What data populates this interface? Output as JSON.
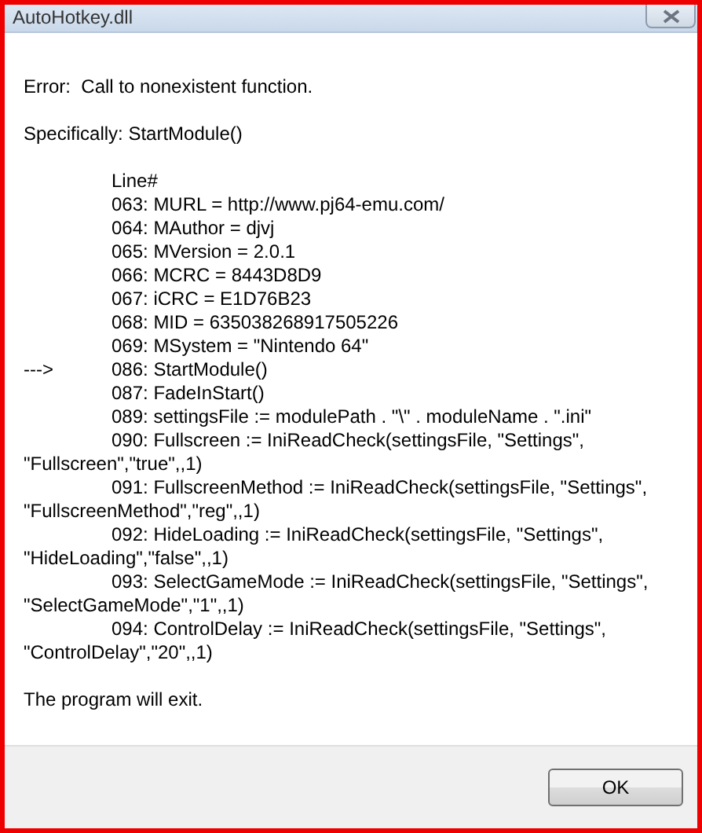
{
  "window": {
    "title": "AutoHotkey.dll"
  },
  "message": {
    "error": "Error:  Call to nonexistent function.",
    "specifically": "Specifically: StartModule()",
    "listing_header": "Line#",
    "lines": [
      {
        "text": "063: MURL = http://www.pj64-emu.com/"
      },
      {
        "text": "064: MAuthor = djvj"
      },
      {
        "text": "065: MVersion = 2.0.1"
      },
      {
        "text": "066: MCRC = 8443D8D9"
      },
      {
        "text": "067: iCRC = E1D76B23"
      },
      {
        "text": "068: MID = 635038268917505226"
      },
      {
        "text": "069: MSystem = \"Nintendo 64\""
      },
      {
        "marker": "--->",
        "text": "086: StartModule()"
      },
      {
        "text": "087: FadeInStart()"
      },
      {
        "text": "089: settingsFile := modulePath . \"\\\" . moduleName . \".ini\""
      },
      {
        "text": "090: Fullscreen := IniReadCheck(settingsFile, \"Settings\", \"Fullscreen\",\"true\",,1)"
      },
      {
        "text": "091: FullscreenMethod := IniReadCheck(settingsFile, \"Settings\", \"FullscreenMethod\",\"reg\",,1)"
      },
      {
        "text": "092: HideLoading := IniReadCheck(settingsFile, \"Settings\", \"HideLoading\",\"false\",,1)"
      },
      {
        "text": "093: SelectGameMode := IniReadCheck(settingsFile, \"Settings\", \"SelectGameMode\",\"1\",,1)"
      },
      {
        "text": "094: ControlDelay := IniReadCheck(settingsFile, \"Settings\", \"ControlDelay\",\"20\",,1)"
      }
    ],
    "closing": "The program will exit."
  },
  "buttons": [
    {
      "label": "OK"
    }
  ]
}
